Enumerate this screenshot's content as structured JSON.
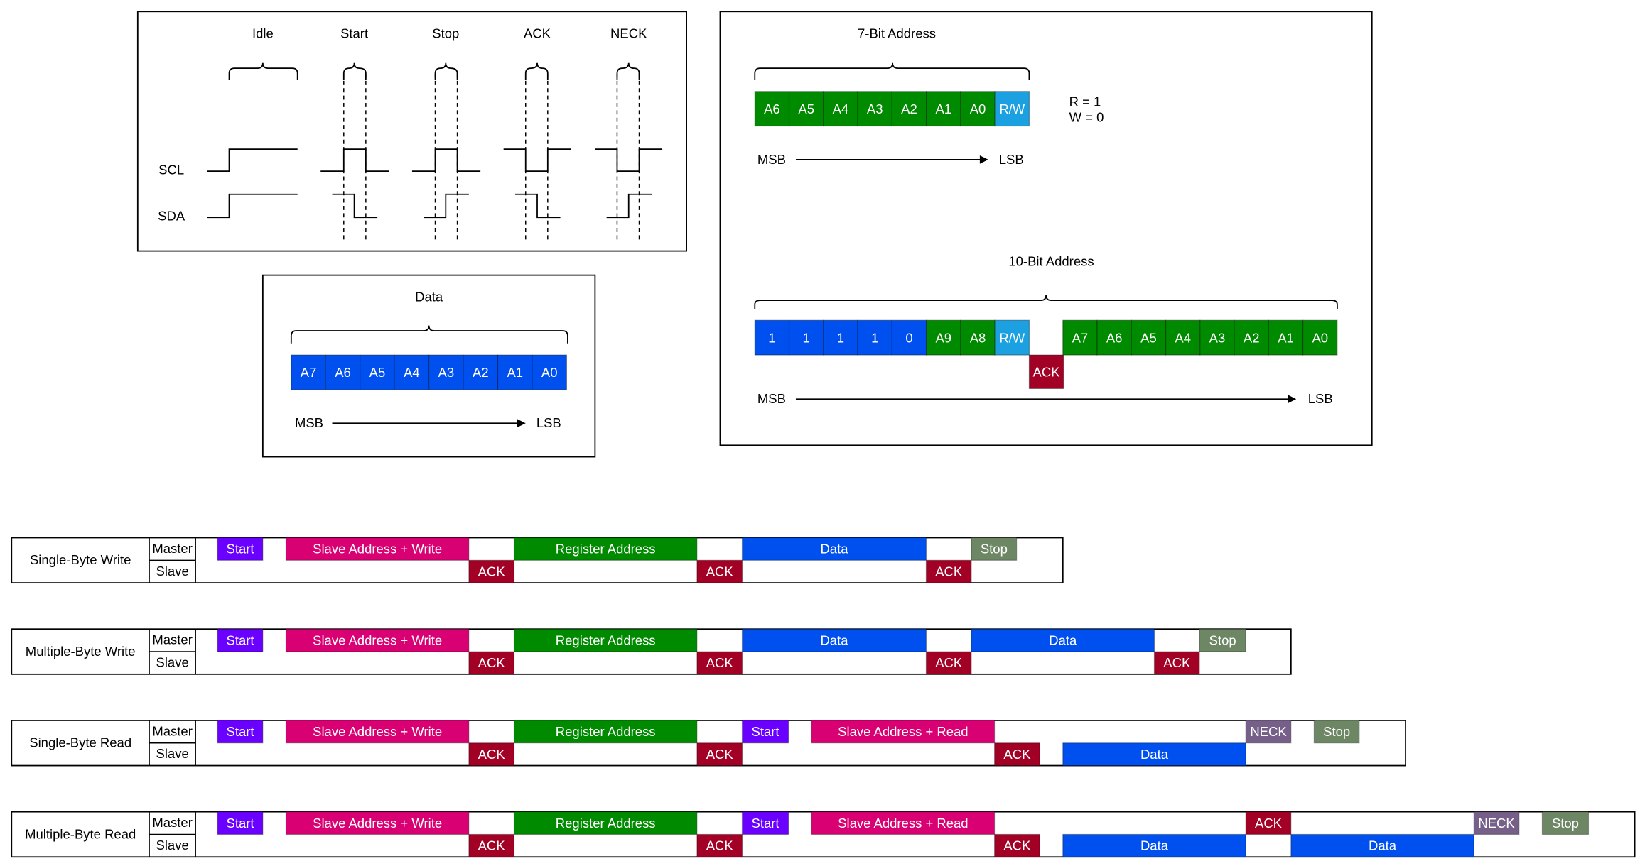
{
  "signals": {
    "states": [
      "Idle",
      "Start",
      "Stop",
      "ACK",
      "NECK"
    ],
    "scl_label": "SCL",
    "sda_label": "SDA"
  },
  "data_frame": {
    "title": "Data",
    "bits": [
      "A7",
      "A6",
      "A5",
      "A4",
      "A3",
      "A2",
      "A1",
      "A0"
    ],
    "msb": "MSB",
    "lsb": "LSB",
    "color": "#0050ef"
  },
  "address_7bit": {
    "title": "7-Bit Address",
    "bits": [
      "A6",
      "A5",
      "A4",
      "A3",
      "A2",
      "A1",
      "A0",
      "R/W"
    ],
    "rw_note": [
      "R = 1",
      "W = 0"
    ],
    "msb": "MSB",
    "lsb": "LSB"
  },
  "address_10bit": {
    "title": "10-Bit Address",
    "first_byte": [
      "1",
      "1",
      "1",
      "1",
      "0",
      "A9",
      "A8",
      "R/W"
    ],
    "ack": "ACK",
    "second_byte": [
      "A7",
      "A6",
      "A5",
      "A4",
      "A3",
      "A2",
      "A1",
      "A0"
    ],
    "msb": "MSB",
    "lsb": "LSB"
  },
  "colors": {
    "green": "#008a00",
    "blue": "#0050ef",
    "light_blue": "#1ba1e2",
    "ack_red": "#a20025",
    "start_purple": "#6a00ff",
    "address_magenta": "#d80073",
    "stop_olive": "#6d8764",
    "neck_violet": "#76608a"
  },
  "transactions": [
    {
      "name": "Single-Byte Write",
      "master": "Master",
      "slave": "Slave",
      "segments": [
        {
          "label": "Start",
          "lane": "master",
          "color": "start_purple"
        },
        {
          "label": "Slave Address + Write",
          "lane": "master",
          "color": "address_magenta"
        },
        {
          "label": "ACK",
          "lane": "slave",
          "color": "ack_red"
        },
        {
          "label": "Register Address",
          "lane": "master",
          "color": "green"
        },
        {
          "label": "ACK",
          "lane": "slave",
          "color": "ack_red"
        },
        {
          "label": "Data",
          "lane": "master",
          "color": "blue"
        },
        {
          "label": "ACK",
          "lane": "slave",
          "color": "ack_red"
        },
        {
          "label": "Stop",
          "lane": "master",
          "color": "stop_olive"
        }
      ]
    },
    {
      "name": "Multiple-Byte Write",
      "master": "Master",
      "slave": "Slave",
      "segments": [
        {
          "label": "Start",
          "lane": "master",
          "color": "start_purple"
        },
        {
          "label": "Slave Address + Write",
          "lane": "master",
          "color": "address_magenta"
        },
        {
          "label": "ACK",
          "lane": "slave",
          "color": "ack_red"
        },
        {
          "label": "Register Address",
          "lane": "master",
          "color": "green"
        },
        {
          "label": "ACK",
          "lane": "slave",
          "color": "ack_red"
        },
        {
          "label": "Data",
          "lane": "master",
          "color": "blue"
        },
        {
          "label": "ACK",
          "lane": "slave",
          "color": "ack_red"
        },
        {
          "label": "Data",
          "lane": "master",
          "color": "blue"
        },
        {
          "label": "ACK",
          "lane": "slave",
          "color": "ack_red"
        },
        {
          "label": "Stop",
          "lane": "master",
          "color": "stop_olive"
        }
      ]
    },
    {
      "name": "Single-Byte Read",
      "master": "Master",
      "slave": "Slave",
      "segments": [
        {
          "label": "Start",
          "lane": "master",
          "color": "start_purple"
        },
        {
          "label": "Slave Address + Write",
          "lane": "master",
          "color": "address_magenta"
        },
        {
          "label": "ACK",
          "lane": "slave",
          "color": "ack_red"
        },
        {
          "label": "Register Address",
          "lane": "master",
          "color": "green"
        },
        {
          "label": "ACK",
          "lane": "slave",
          "color": "ack_red"
        },
        {
          "label": "Start",
          "lane": "master",
          "color": "start_purple"
        },
        {
          "label": "Slave Address + Read",
          "lane": "master",
          "color": "address_magenta"
        },
        {
          "label": "ACK",
          "lane": "slave",
          "color": "ack_red"
        },
        {
          "label": "Data",
          "lane": "slave",
          "color": "blue"
        },
        {
          "label": "NECK",
          "lane": "master",
          "color": "neck_violet"
        },
        {
          "label": "Stop",
          "lane": "master",
          "color": "stop_olive"
        }
      ]
    },
    {
      "name": "Multiple-Byte Read",
      "master": "Master",
      "slave": "Slave",
      "segments": [
        {
          "label": "Start",
          "lane": "master",
          "color": "start_purple"
        },
        {
          "label": "Slave Address + Write",
          "lane": "master",
          "color": "address_magenta"
        },
        {
          "label": "ACK",
          "lane": "slave",
          "color": "ack_red"
        },
        {
          "label": "Register Address",
          "lane": "master",
          "color": "green"
        },
        {
          "label": "ACK",
          "lane": "slave",
          "color": "ack_red"
        },
        {
          "label": "Start",
          "lane": "master",
          "color": "start_purple"
        },
        {
          "label": "Slave Address + Read",
          "lane": "master",
          "color": "address_magenta"
        },
        {
          "label": "ACK",
          "lane": "slave",
          "color": "ack_red"
        },
        {
          "label": "Data",
          "lane": "slave",
          "color": "blue"
        },
        {
          "label": "ACK",
          "lane": "master",
          "color": "ack_red"
        },
        {
          "label": "Data",
          "lane": "slave",
          "color": "blue"
        },
        {
          "label": "NECK",
          "lane": "master",
          "color": "neck_violet"
        },
        {
          "label": "Stop",
          "lane": "master",
          "color": "stop_olive"
        }
      ]
    }
  ]
}
